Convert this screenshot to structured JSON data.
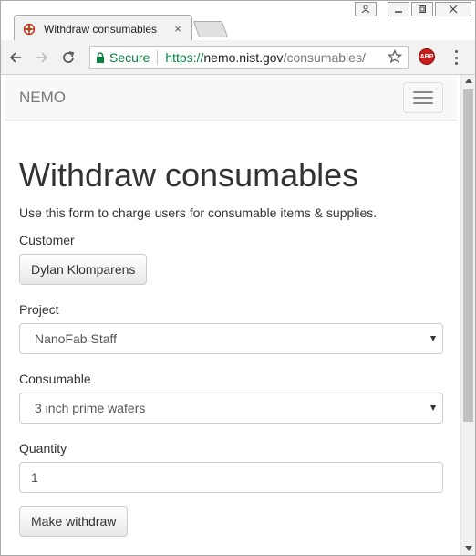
{
  "browser": {
    "tab_title": "Withdraw consumables",
    "tab_close": "×",
    "secure_label": "Secure",
    "url_scheme": "https://",
    "url_host": "nemo.nist.gov",
    "url_path": "/consumables/",
    "abp_label": "ABP"
  },
  "navbar": {
    "brand": "NEMO"
  },
  "page": {
    "title": "Withdraw consumables",
    "intro": "Use this form to charge users for consumable items & supplies.",
    "customer_label": "Customer",
    "customer_value": "Dylan Klomparens",
    "project_label": "Project",
    "project_value": "NanoFab Staff",
    "consumable_label": "Consumable",
    "consumable_value": "3 inch prime wafers",
    "quantity_label": "Quantity",
    "quantity_value": "1",
    "submit_label": "Make withdraw"
  }
}
